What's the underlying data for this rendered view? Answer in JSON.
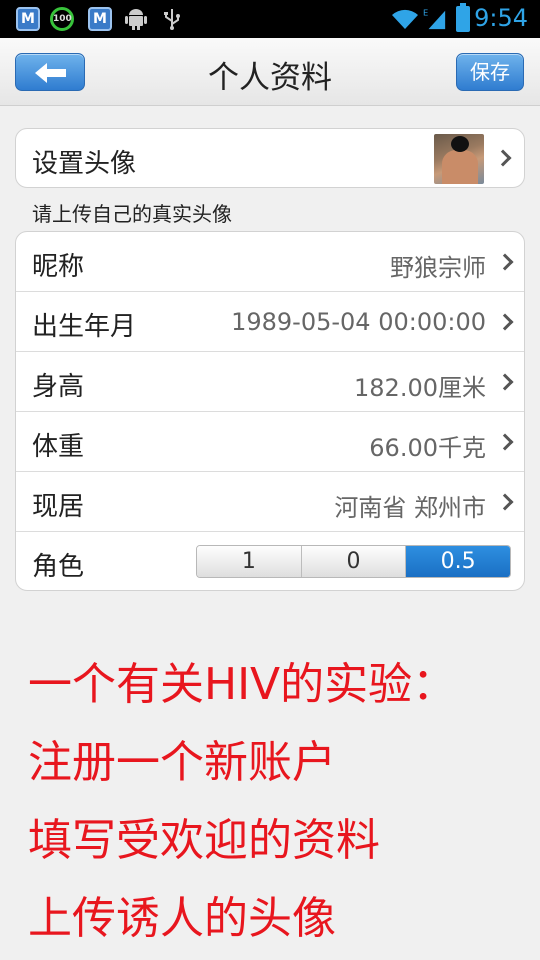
{
  "status_bar": {
    "time": "9:54",
    "icons": [
      "m-app-icon",
      "battery-100-icon",
      "m-app-mail-icon",
      "android-icon",
      "usb-icon",
      "wifi-icon",
      "signal-icon",
      "battery-icon"
    ],
    "badge_100": "100",
    "m_letter": "M"
  },
  "header": {
    "title": "个人资料",
    "save_label": "保存",
    "accent": "#2f7cd0"
  },
  "avatar_row": {
    "label": "设置头像"
  },
  "hint": "请上传自己的真实头像",
  "profile_rows": [
    {
      "label": "昵称",
      "value": "野狼宗师"
    },
    {
      "label": "出生年月",
      "value": "1989-05-04 00:00:00"
    },
    {
      "label": "身高",
      "value": "182.00厘米"
    },
    {
      "label": "体重",
      "value": "66.00千克"
    },
    {
      "label": "现居",
      "value": "河南省 郑州市"
    }
  ],
  "role": {
    "label": "角色",
    "options": [
      "1",
      "0",
      "0.5"
    ],
    "selected": "0.5"
  },
  "overlay_text": [
    "一个有关HIV的实验：",
    "注册一个新账户",
    "填写受欢迎的资料",
    "上传诱人的头像"
  ],
  "overlay_color": "#e8161e"
}
